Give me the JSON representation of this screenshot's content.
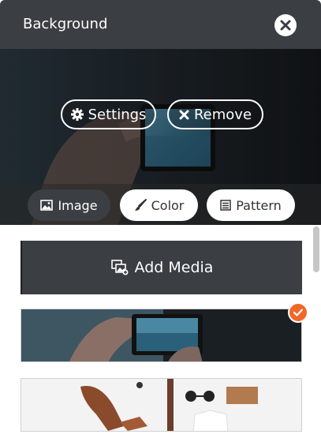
{
  "header": {
    "title": "Background"
  },
  "preview": {
    "settings_label": "Settings",
    "remove_label": "Remove"
  },
  "tabs": [
    {
      "label": "Image",
      "icon": "image-icon",
      "active": true
    },
    {
      "label": "Color",
      "icon": "brush-icon",
      "active": false
    },
    {
      "label": "Pattern",
      "icon": "pattern-icon",
      "active": false
    }
  ],
  "media": {
    "add_label": "Add Media",
    "items": [
      {
        "name": "hands-phone-photo",
        "selected": true
      },
      {
        "name": "flat-lay-shoes-photo",
        "selected": false
      }
    ]
  },
  "colors": {
    "header": "#3b3e42",
    "accent": "#f0682a",
    "tab_active": "#3b3e42"
  }
}
